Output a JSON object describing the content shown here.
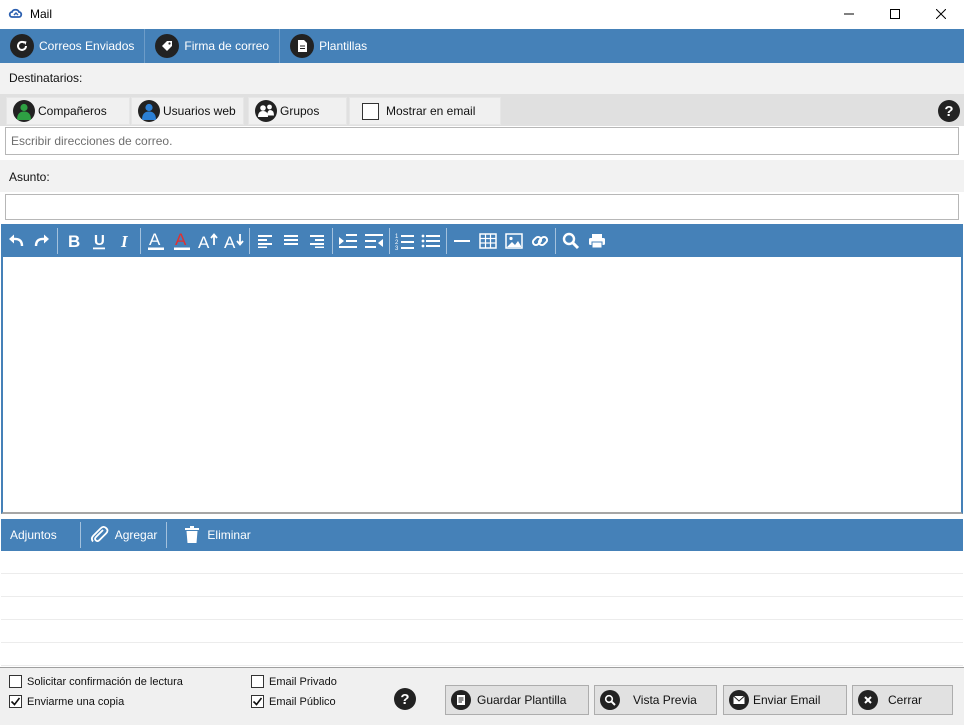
{
  "window": {
    "title": "Mail"
  },
  "topbar": {
    "sent_mail": "Correos Enviados",
    "signature": "Firma de correo",
    "templates": "Plantillas"
  },
  "recipients": {
    "label": "Destinatarios:",
    "tabs": [
      "Compañeros",
      "Usuarios web",
      "Grupos"
    ],
    "show_in_email": "Mostrar en email",
    "input_placeholder": "Escribir direcciones de correo."
  },
  "subject": {
    "label": "Asunto:",
    "value": ""
  },
  "attachments": {
    "label": "Adjuntos",
    "add": "Agregar",
    "remove": "Eliminar",
    "rows": 5
  },
  "footer": {
    "read_receipt": "Solicitar confirmación de lectura",
    "send_copy": "Enviarme una copia",
    "private_email": "Email Privado",
    "public_email": "Email Público",
    "save_template": "Guardar Plantilla",
    "preview": "Vista Previa",
    "send": "Enviar Email",
    "close": "Cerrar"
  },
  "state": {
    "show_in_email_checked": false,
    "read_receipt_checked": false,
    "send_copy_checked": true,
    "private_email_checked": false,
    "public_email_checked": true
  },
  "colors": {
    "accent": "#4581b8",
    "user_green": "#2ea043",
    "user_blue": "#2b7fd4"
  }
}
